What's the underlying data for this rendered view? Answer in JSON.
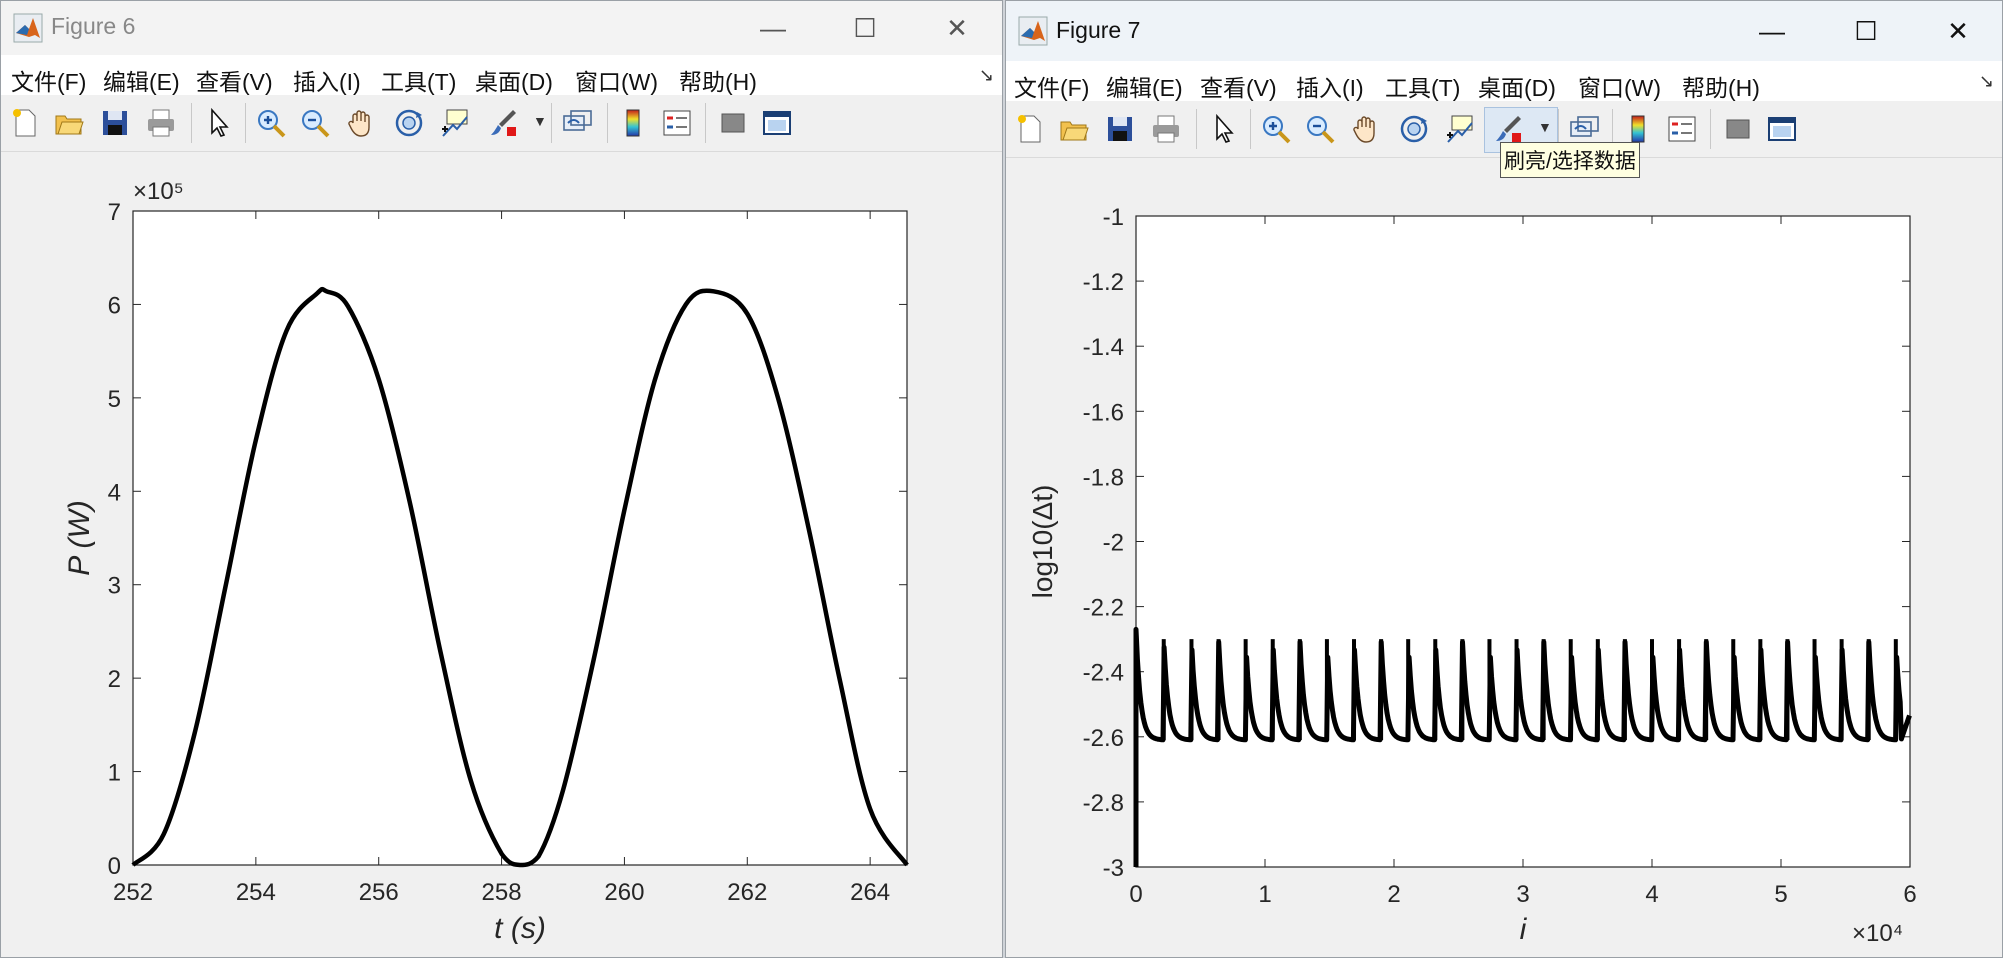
{
  "windows": [
    {
      "title": "Figure 6",
      "menu": [
        "文件(F)",
        "编辑(E)",
        "查看(V)",
        "插入(I)",
        "工具(T)",
        "桌面(D)",
        "窗口(W)",
        "帮助(H)"
      ]
    },
    {
      "title": "Figure 7",
      "menu": [
        "文件(F)",
        "编辑(E)",
        "查看(V)",
        "插入(I)",
        "工具(T)",
        "桌面(D)",
        "窗口(W)",
        "帮助(H)"
      ]
    }
  ],
  "window_buttons": {
    "minimize": "—",
    "maximize": "☐",
    "close": "✕"
  },
  "toolbar_icons": [
    "new-figure-icon",
    "open-file-icon",
    "save-icon",
    "print-icon",
    "edit-plot-arrow-icon",
    "zoom-in-icon",
    "zoom-out-icon",
    "pan-hand-icon",
    "rotate-3d-icon",
    "data-cursor-icon",
    "brush-icon",
    "link-plot-icon",
    "colorbar-icon",
    "legend-icon",
    "hide-plot-tools-icon",
    "show-plot-tools-icon"
  ],
  "tooltip": "刷亮/选择数据",
  "chart_data": [
    {
      "type": "line",
      "title": "",
      "xlabel": "t (s)",
      "ylabel": "P (W)",
      "xlim": [
        252,
        264.6
      ],
      "ylim": [
        0,
        700000
      ],
      "xticks": [
        "252",
        "254",
        "256",
        "258",
        "260",
        "262",
        "264"
      ],
      "yticks": [
        "0",
        "1",
        "2",
        "3",
        "4",
        "5",
        "6",
        "7"
      ],
      "y_exponent": "×10⁵",
      "grid": false,
      "color": "#000000",
      "series": [
        {
          "x": [
            252.0,
            252.5,
            253.0,
            253.5,
            254.0,
            254.5,
            255.0,
            255.15,
            255.5,
            256.0,
            256.5,
            257.0,
            257.5,
            258.0,
            258.3,
            258.6,
            259.0,
            259.5,
            260.0,
            260.5,
            261.0,
            261.45,
            262.0,
            262.5,
            263.0,
            263.5,
            264.0,
            264.6
          ],
          "y": [
            0,
            33000,
            140000,
            296000,
            455000,
            572000,
            612000,
            614000,
            598000,
            520000,
            390000,
            230000,
            90000,
            12000,
            0,
            9000,
            80000,
            220000,
            380000,
            520000,
            600000,
            614000,
            590000,
            500000,
            360000,
            200000,
            60000,
            0
          ]
        }
      ]
    },
    {
      "type": "line",
      "title": "",
      "xlabel": "i",
      "ylabel": "log10(Δt)",
      "xlim": [
        0,
        60000
      ],
      "ylim": [
        -3,
        -1
      ],
      "xticks": [
        "0",
        "1",
        "2",
        "3",
        "4",
        "5",
        "6"
      ],
      "x_exponent": "×10⁴",
      "yticks": [
        "-1",
        "-1.2",
        "-1.4",
        "-1.6",
        "-1.8",
        "-2",
        "-2.2",
        "-2.4",
        "-2.6",
        "-2.8",
        "-3"
      ],
      "grid": false,
      "color": "#000000",
      "series": [
        {
          "name": "",
          "start": {
            "x": 0,
            "y": -3.0,
            "peak": -2.27
          },
          "peaks_x": [
            2150,
            4300,
            6400,
            8500,
            10600,
            12700,
            14800,
            16900,
            19000,
            21100,
            23200,
            25300,
            27400,
            29500,
            31600,
            33700,
            35800,
            37900,
            40000,
            42100,
            44200,
            46300,
            48400,
            50500,
            52600,
            54700,
            56800,
            58900
          ],
          "peak_y": -2.3,
          "secondary_peak_y": -2.45,
          "trough_y": -2.61,
          "end_y": -2.53
        }
      ]
    }
  ]
}
